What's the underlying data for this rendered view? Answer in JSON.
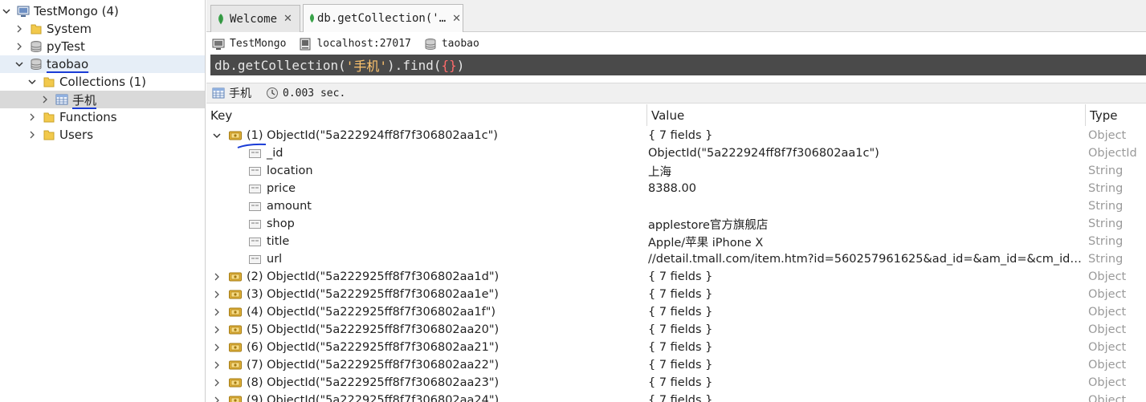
{
  "sidebar": {
    "connection": "TestMongo (4)",
    "databases": [
      {
        "name": "System"
      },
      {
        "name": "pyTest"
      },
      {
        "name": "taobao"
      }
    ],
    "collections_folder": "Collections (1)",
    "collection": "手机",
    "functions": "Functions",
    "users": "Users"
  },
  "tabs": [
    {
      "label": "Welcome",
      "close": "✕"
    },
    {
      "label": "db.getCollection('…",
      "close": "✕"
    }
  ],
  "info": {
    "connection": "TestMongo",
    "host": "localhost:27017",
    "database": "taobao"
  },
  "query": {
    "prefix": "db.getCollection(",
    "arg": "'手机'",
    "mid": ").find(",
    "braces": "{}",
    "suffix": ")"
  },
  "result": {
    "collection": "手机",
    "time": "0.003 sec."
  },
  "grid": {
    "columns": {
      "key": "Key",
      "value": "Value",
      "type": "Type"
    },
    "rows": [
      {
        "kind": "doc",
        "expanded": true,
        "key": "(1) ObjectId(\"5a222924ff8f7f306802aa1c\")",
        "value": "{ 7 fields }",
        "type": "Object"
      },
      {
        "kind": "field",
        "key": "_id",
        "value": "ObjectId(\"5a222924ff8f7f306802aa1c\")",
        "type": "ObjectId"
      },
      {
        "kind": "field",
        "key": "location",
        "value": "上海",
        "type": "String"
      },
      {
        "kind": "field",
        "key": "price",
        "value": "8388.00",
        "type": "String"
      },
      {
        "kind": "field",
        "key": "amount",
        "value": "",
        "type": "String"
      },
      {
        "kind": "field",
        "key": "shop",
        "value": "applestore官方旗舰店",
        "type": "String"
      },
      {
        "kind": "field",
        "key": "title",
        "value": "Apple/苹果 iPhone X",
        "type": "String"
      },
      {
        "kind": "field",
        "key": "url",
        "value": "//detail.tmall.com/item.htm?id=560257961625&ad_id=&am_id=&cm_id=...",
        "type": "String"
      },
      {
        "kind": "doc",
        "expanded": false,
        "key": "(2) ObjectId(\"5a222925ff8f7f306802aa1d\")",
        "value": "{ 7 fields }",
        "type": "Object"
      },
      {
        "kind": "doc",
        "expanded": false,
        "key": "(3) ObjectId(\"5a222925ff8f7f306802aa1e\")",
        "value": "{ 7 fields }",
        "type": "Object"
      },
      {
        "kind": "doc",
        "expanded": false,
        "key": "(4) ObjectId(\"5a222925ff8f7f306802aa1f\")",
        "value": "{ 7 fields }",
        "type": "Object"
      },
      {
        "kind": "doc",
        "expanded": false,
        "key": "(5) ObjectId(\"5a222925ff8f7f306802aa20\")",
        "value": "{ 7 fields }",
        "type": "Object"
      },
      {
        "kind": "doc",
        "expanded": false,
        "key": "(6) ObjectId(\"5a222925ff8f7f306802aa21\")",
        "value": "{ 7 fields }",
        "type": "Object"
      },
      {
        "kind": "doc",
        "expanded": false,
        "key": "(7) ObjectId(\"5a222925ff8f7f306802aa22\")",
        "value": "{ 7 fields }",
        "type": "Object"
      },
      {
        "kind": "doc",
        "expanded": false,
        "key": "(8) ObjectId(\"5a222925ff8f7f306802aa23\")",
        "value": "{ 7 fields }",
        "type": "Object"
      },
      {
        "kind": "doc",
        "expanded": false,
        "key": "(9) ObjectId(\"5a222925ff8f7f306802aa24\")",
        "value": "{ 7 fields }",
        "type": "Object"
      }
    ]
  },
  "colors": {
    "query_bg": "#4a4a4a",
    "query_string": "#ffc46d",
    "query_brace": "#ff6b6b",
    "selection_bg": "#e6eef7",
    "annotation_underline": "#1a3cd6",
    "mongo_leaf": "#3aa34a"
  },
  "icons": {
    "connection": "computer-icon",
    "folder": "folder-icon",
    "database": "database-icon",
    "collection": "table-icon",
    "document": "document-key-icon",
    "field": "string-field-icon",
    "clock": "clock-icon",
    "mongo": "mongo-leaf-icon"
  }
}
